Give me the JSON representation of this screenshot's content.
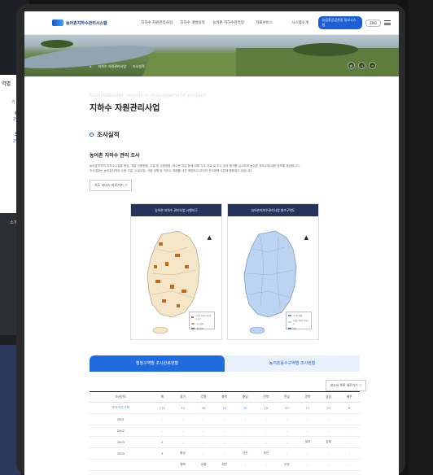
{
  "background": {
    "left_text": [
      "역별",
      "기",
      "6",
      "2%",
      "5",
      "2%",
      "소개"
    ]
  },
  "header": {
    "logo": "농어촌지하수관리시스템",
    "nav": [
      "지하수 자원관리사업",
      "지하수 개발실적",
      "농어촌 지하수관측망",
      "자료서비스",
      "시스템소개"
    ],
    "cta": "농업용공공관정 정보시스템",
    "lang": "ENG"
  },
  "hero": {
    "breadcrumb": [
      "지하수 자원관리사업",
      "조사실적"
    ]
  },
  "page": {
    "eng_title": "Groundwater resource management project",
    "title": "지하수 자원관리사업",
    "section": "조사실적",
    "subsection": "농어촌 지하수 관리 조사",
    "desc_lines": [
      "농어촌지역의 지하수수질을 정성, 개발 이용현황, 수질 및 수량현황, 대수층 특성 등에 대해 기초 자료 및 조사 분석 평가를 실시하며 농어촌 지하수에 대한 정보를 제공합니다.",
      "조사결과는 농어촌지역의 수량 고갈, 수질오염, 가뭄 대책 등 지하수 재해를 사전 예방하고 보전과 관리대책 수립에 활용되고 있습니다."
    ],
    "map_link": "지도 서비스 바로가기"
  },
  "maps": [
    {
      "header": "농어촌 지하수 관리사업 시행지구",
      "legend": [
        "농어촌 지하수 관리조사 지구",
        "시군 경계",
        "광역 경계"
      ]
    },
    {
      "header": "농어촌지하수관리사업 총수구역도",
      "legend": [
        "수구역 경계",
        "농어촌 지하수 관리조사",
        "하천"
      ]
    }
  ],
  "tabs": [
    "행정구역별 조사완료현황",
    "농어촌용수구역별 조사현황"
  ],
  "report_button": "보고서 목록 바로가기",
  "table": {
    "headers": [
      "조사년도",
      "계",
      "경기",
      "강원",
      "충북",
      "충남",
      "전북",
      "전남",
      "경북",
      "경남",
      "제주"
    ],
    "rows": [
      [
        "조사구간 구획",
        "175",
        "23",
        "18",
        "14",
        "15",
        "19",
        "29",
        "27",
        "24",
        "6"
      ],
      [
        "2001",
        "-",
        "-",
        "-",
        "-",
        "-",
        "-",
        "-",
        "-",
        "-",
        "-"
      ],
      [
        "2002",
        "-",
        "-",
        "-",
        "-",
        "-",
        "-",
        "-",
        "-",
        "-",
        "-"
      ],
      [
        "2003",
        "2",
        "-",
        "-",
        "-",
        "-",
        "-",
        "-",
        "칠곡",
        "김해",
        "-"
      ],
      [
        "2004",
        "3",
        "화성",
        "-",
        "-",
        "아산",
        "부안",
        "-",
        "-",
        "-",
        "-"
      ],
      [
        "",
        "",
        "평택",
        "강릉",
        "제천",
        "-",
        "-",
        "무안",
        "-",
        "-",
        "-"
      ],
      [
        "2005",
        "5",
        "",
        "",
        "",
        "",
        "",
        "",
        "",
        "",
        ""
      ]
    ]
  },
  "colors": {
    "accent": "#1f6be0",
    "map_header": "#24345a",
    "land_left": "#f5e6c8",
    "land_right": "#bcd4f2"
  }
}
